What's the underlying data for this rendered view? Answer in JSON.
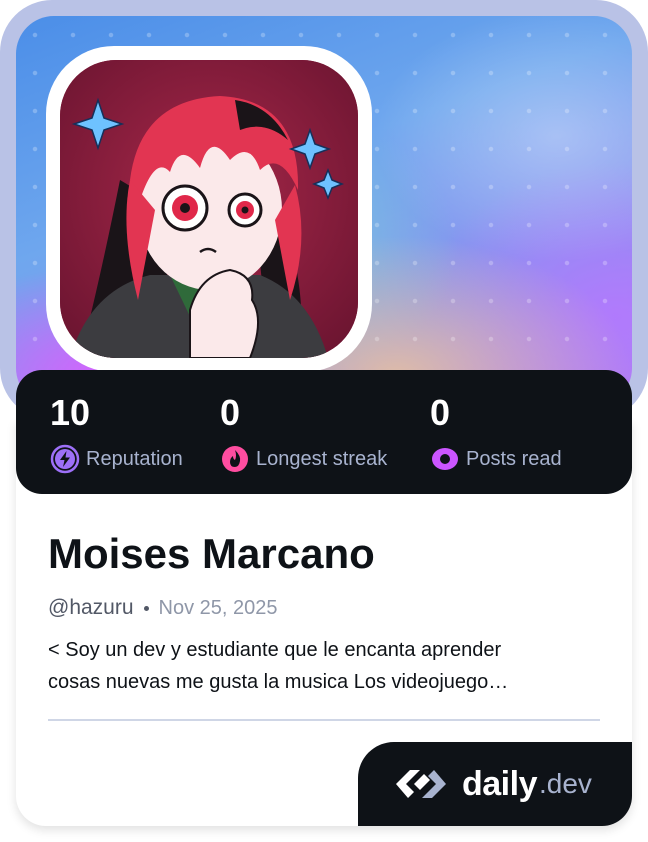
{
  "profile": {
    "name": "Moises Marcano",
    "handle": "@hazuru",
    "joined": "Nov 25, 2025",
    "bio_line1": "< Soy un dev y estudiante que le encanta aprender",
    "bio_line2": "cosas nuevas me gusta la musica Los videojuego…"
  },
  "stats": [
    {
      "value": "10",
      "label": "Reputation",
      "icon": "lightning-icon",
      "color": "#9d70f8"
    },
    {
      "value": "0",
      "label": "Longest streak",
      "icon": "flame-icon",
      "color": "#ff4da0"
    },
    {
      "value": "0",
      "label": "Posts read",
      "icon": "eye-icon",
      "color": "#cb55ff"
    }
  ],
  "brand": {
    "name": "daily",
    "tld": ".dev"
  },
  "colors": {
    "card_dark": "#0e1217",
    "frame": "#b9c2e6",
    "muted_text": "#a8b3cf"
  }
}
